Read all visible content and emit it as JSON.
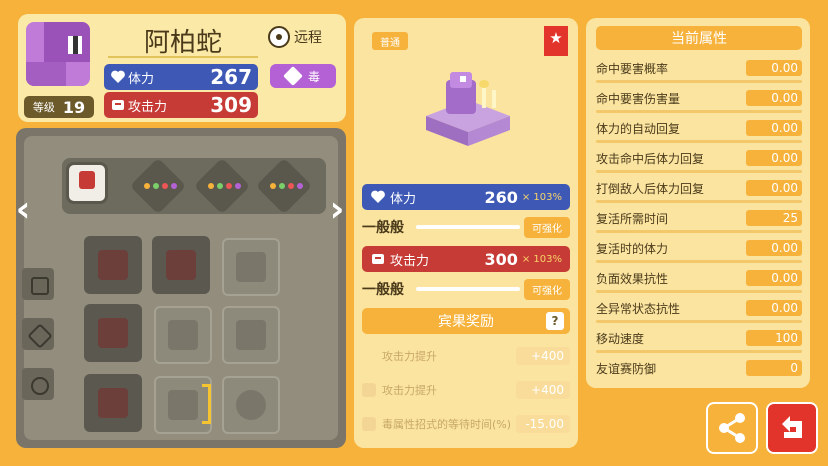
{
  "pokemon": {
    "name": "阿柏蛇",
    "level_label": "等级",
    "level": "19",
    "range": "远程",
    "type": "毒",
    "hp_label": "体力",
    "hp": "267",
    "atk_label": "攻击力",
    "atk": "309"
  },
  "move": {
    "rarity": "普通",
    "hp_label": "体力",
    "hp": "260",
    "hp_mult": "× 103%",
    "hp_rank": "一般般",
    "atk_label": "攻击力",
    "atk": "300",
    "atk_mult": "× 103%",
    "atk_rank": "一般般",
    "enhance_label": "可强化",
    "bingo_title": "宾果奖励",
    "bingo_help": "?",
    "bonuses": [
      {
        "label": "攻击力提升",
        "value": "+400"
      },
      {
        "label": "攻击力提升",
        "value": "+400"
      },
      {
        "label": "毒属性招式的等待时间(%)",
        "value": "-15.00"
      }
    ]
  },
  "attributes": {
    "title": "当前属性",
    "rows": [
      {
        "label": "命中要害概率",
        "value": "0.00"
      },
      {
        "label": "命中要害伤害量",
        "value": "0.00"
      },
      {
        "label": "体力的自动回复",
        "value": "0.00"
      },
      {
        "label": "攻击命中后体力回复",
        "value": "0.00"
      },
      {
        "label": "打倒敌人后体力回复",
        "value": "0.00"
      },
      {
        "label": "复活所需时间",
        "value": "25"
      },
      {
        "label": "复活时的体力",
        "value": "0.00"
      },
      {
        "label": "负面效果抗性",
        "value": "0.00"
      },
      {
        "label": "全异常状态抗性",
        "value": "0.00"
      },
      {
        "label": "移动速度",
        "value": "100"
      },
      {
        "label": "友谊赛防御",
        "value": "0"
      }
    ]
  },
  "colors": {
    "hp": "#3d59b5",
    "atk": "#c63b35",
    "accent": "#f6b23a",
    "poison": "#b561d6"
  },
  "icons": [
    "heart-icon",
    "fist-icon",
    "star-icon",
    "share-icon",
    "back-icon",
    "range-icon",
    "poison-type-icon"
  ]
}
